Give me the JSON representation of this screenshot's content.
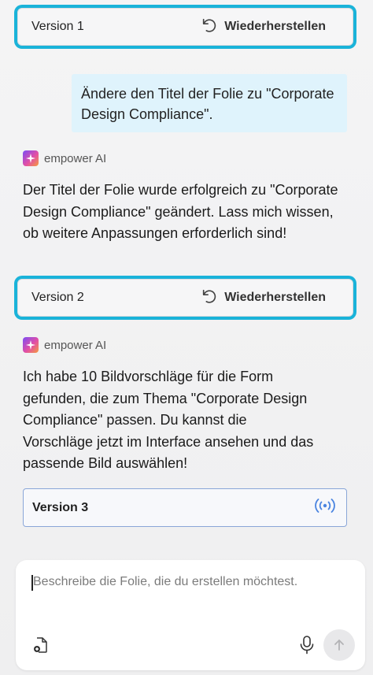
{
  "messages": {
    "version1": {
      "label": "Version 1",
      "restore_label": "Wiederherstellen"
    },
    "user_message": "Ändere den Titel der Folie zu \"Corporate Design Compliance\".",
    "ai1": {
      "sender": "empower AI",
      "text": "Der Titel der Folie wurde erfolgreich zu \"Corporate Design Compliance\" geändert. Lass mich wissen, ob weitere Anpassungen erforderlich sind!"
    },
    "version2": {
      "label": "Version 2",
      "restore_label": "Wiederherstellen"
    },
    "ai2": {
      "sender": "empower AI",
      "text": "Ich habe 10 Bildvorschläge für die Form gefunden, die zum Thema \"Corporate Design Compliance\" passen. Du kannst die Vorschläge jetzt im Interface ansehen und das passende Bild auswählen!"
    },
    "version3": {
      "label": "Version 3"
    }
  },
  "composer": {
    "placeholder": "Beschreibe die Folie, die du erstellen möchtest."
  },
  "colors": {
    "highlight": "#1ab3d9",
    "user_bubble": "#dff3fc",
    "live_icon": "#4a84e0"
  },
  "icons": {
    "restore": "undo-icon",
    "live": "broadcast-icon",
    "attach": "add-file-icon",
    "mic": "microphone-icon",
    "send": "arrow-up-icon"
  }
}
